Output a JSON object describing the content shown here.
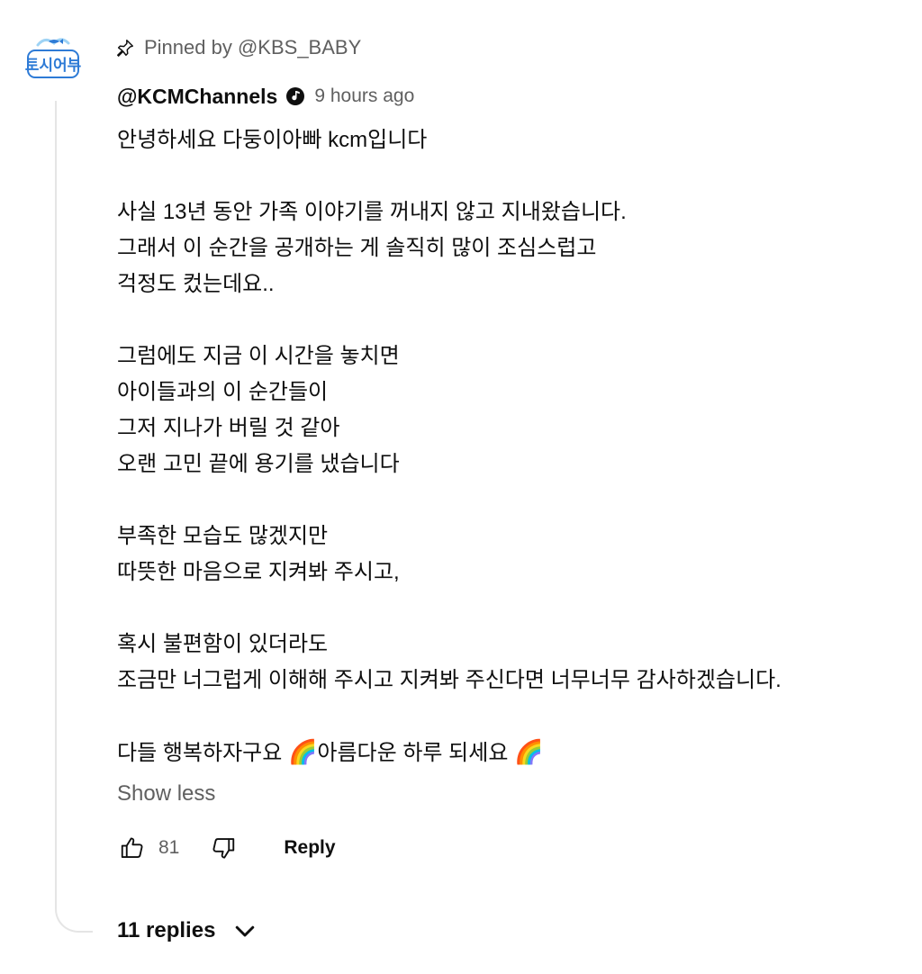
{
  "channel_avatar": {
    "icon": "channel-logo",
    "logo_text": "토시어부",
    "colors": {
      "primary": "#2e7bd6",
      "secondary": "#9ed3f5"
    }
  },
  "pinned": {
    "icon": "pin-icon",
    "label": "Pinned by @KBS_BABY"
  },
  "comment": {
    "author": "@KCMChannels",
    "verified_icon": "music-verified-icon",
    "timestamp": "9 hours ago",
    "lines": [
      "안녕하세요 다둥이아빠 kcm입니다",
      "",
      "사실 13년 동안 가족 이야기를 꺼내지 않고 지내왔습니다.",
      "그래서 이 순간을 공개하는 게 솔직히 많이 조심스럽고",
      "걱정도 컸는데요..",
      "",
      "그럼에도 지금 이 시간을 놓치면",
      "아이들과의 이 순간들이",
      "그저 지나가 버릴 것 같아",
      "오랜 고민 끝에 용기를 냈습니다",
      "",
      "부족한 모습도 많겠지만",
      "따뜻한 마음으로 지켜봐 주시고,",
      "",
      "혹시 불편함이 있더라도",
      "조금만 너그럽게 이해해 주시고 지켜봐 주신다면 너무너무 감사하겠습니다.",
      ""
    ],
    "last_line": {
      "part1": "다들 행복하자구요 ",
      "emoji1": "🌈",
      "part2": "아름다운 하루 되세요 ",
      "emoji2": "🌈"
    },
    "show_less_label": "Show less"
  },
  "actions": {
    "like_icon": "thumbs-up-icon",
    "like_count": "81",
    "dislike_icon": "thumbs-down-icon",
    "reply_label": "Reply"
  },
  "replies": {
    "label": "11 replies",
    "icon": "chevron-down-icon"
  },
  "colors": {
    "text_primary": "#0f0f0f",
    "text_secondary": "#606060",
    "thread_line": "#e5e5e5"
  }
}
